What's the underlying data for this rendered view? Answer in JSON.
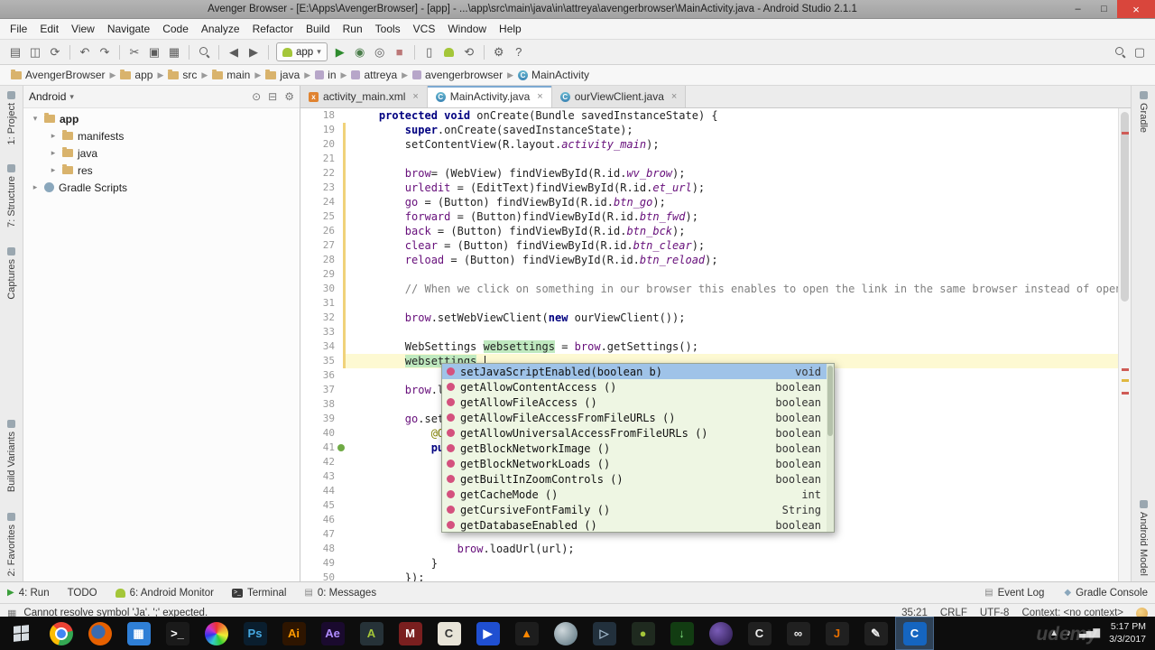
{
  "window": {
    "title": "Avenger Browser - [E:\\Apps\\AvengerBrowser] - [app] - ...\\app\\src\\main\\java\\in\\attreya\\avengerbrowser\\MainActivity.java - Android Studio 2.1.1",
    "controls": {
      "minimize": "–",
      "maximize": "□",
      "close": "×"
    }
  },
  "menu": [
    "File",
    "Edit",
    "View",
    "Navigate",
    "Code",
    "Analyze",
    "Refactor",
    "Build",
    "Run",
    "Tools",
    "VCS",
    "Window",
    "Help"
  ],
  "toolbar": {
    "run_config": "app",
    "items": [
      {
        "kind": "icon",
        "name": "open-icon",
        "glyph": "▤"
      },
      {
        "kind": "icon",
        "name": "save-all-icon",
        "glyph": "◫"
      },
      {
        "kind": "icon",
        "name": "sync-icon",
        "glyph": "⟳"
      },
      {
        "kind": "sep"
      },
      {
        "kind": "icon",
        "name": "undo-icon",
        "glyph": "↶"
      },
      {
        "kind": "icon",
        "name": "redo-icon",
        "glyph": "↷"
      },
      {
        "kind": "sep"
      },
      {
        "kind": "icon",
        "name": "cut-icon",
        "glyph": "✂"
      },
      {
        "kind": "icon",
        "name": "copy-icon",
        "glyph": "▣"
      },
      {
        "kind": "icon",
        "name": "paste-icon",
        "glyph": "▦"
      },
      {
        "kind": "sep"
      },
      {
        "kind": "mag",
        "name": "find-icon"
      },
      {
        "kind": "sep"
      },
      {
        "kind": "icon",
        "name": "back-icon",
        "glyph": "◀"
      },
      {
        "kind": "icon",
        "name": "forward-icon",
        "glyph": "▶"
      },
      {
        "kind": "sep"
      },
      {
        "kind": "runconfig",
        "name": "run-configuration-select"
      },
      {
        "kind": "icon",
        "name": "run-icon",
        "glyph": "▶",
        "color": "#2e8b2e"
      },
      {
        "kind": "icon",
        "name": "debug-icon",
        "glyph": "◉",
        "color": "#4a7d4a"
      },
      {
        "kind": "icon",
        "name": "coverage-icon",
        "glyph": "◎"
      },
      {
        "kind": "icon",
        "name": "stop-icon",
        "glyph": "■",
        "color": "#bb7777"
      },
      {
        "kind": "sep"
      },
      {
        "kind": "icon",
        "name": "avd-manager-icon",
        "glyph": "▯"
      },
      {
        "kind": "droid",
        "name": "sdk-manager-icon"
      },
      {
        "kind": "icon",
        "name": "gradle-sync-icon",
        "glyph": "⟲"
      },
      {
        "kind": "sep"
      },
      {
        "kind": "icon",
        "name": "settings-gear-icon",
        "glyph": "⚙"
      },
      {
        "kind": "icon",
        "name": "help-icon",
        "glyph": "?"
      },
      {
        "kind": "spacer"
      },
      {
        "kind": "mag",
        "name": "search-everywhere-icon"
      },
      {
        "kind": "icon",
        "name": "panel-layout-icon",
        "glyph": "▢"
      }
    ]
  },
  "breadcrumb": [
    {
      "label": "AvengerBrowser",
      "icon": "folder"
    },
    {
      "label": "app",
      "icon": "folder"
    },
    {
      "label": "src",
      "icon": "folder"
    },
    {
      "label": "main",
      "icon": "folder"
    },
    {
      "label": "java",
      "icon": "folder"
    },
    {
      "label": "in",
      "icon": "package"
    },
    {
      "label": "attreya",
      "icon": "package"
    },
    {
      "label": "avengerbrowser",
      "icon": "package"
    },
    {
      "label": "MainActivity",
      "icon": "class"
    }
  ],
  "project": {
    "view": "Android",
    "header_icons": [
      {
        "name": "scroll-to-source-icon",
        "glyph": "⊙"
      },
      {
        "name": "collapse-all-icon",
        "glyph": "⊟"
      },
      {
        "name": "panel-settings-icon",
        "glyph": "⚙"
      }
    ],
    "tree": [
      {
        "label": "app",
        "level": 0,
        "arrow": "▾",
        "icon": "folder",
        "bold": true
      },
      {
        "label": "manifests",
        "level": 1,
        "arrow": "▸",
        "icon": "folder"
      },
      {
        "label": "java",
        "level": 1,
        "arrow": "▸",
        "icon": "folder"
      },
      {
        "label": "res",
        "level": 1,
        "arrow": "▸",
        "icon": "folder"
      },
      {
        "label": "Gradle Scripts",
        "level": 0,
        "arrow": "▸",
        "icon": "gradle"
      }
    ]
  },
  "stripes": {
    "left_top": [
      "1: Project",
      "7: Structure",
      "Captures"
    ],
    "left_bottom": [
      "Build Variants",
      "2: Favorites"
    ],
    "right_top": [
      "Gradle"
    ],
    "right_bottom": [
      "Android Model"
    ]
  },
  "tabs": [
    {
      "label": "activity_main.xml",
      "icon": "xml",
      "active": false
    },
    {
      "label": "MainActivity.java",
      "icon": "class",
      "active": true
    },
    {
      "label": "ourViewClient.java",
      "icon": "class",
      "active": false
    }
  ],
  "editor": {
    "lines": [
      {
        "n": 18,
        "segs": [
          [
            "    ",
            ""
          ],
          [
            "protected",
            "k"
          ],
          [
            " ",
            ""
          ],
          [
            "void",
            "k"
          ],
          [
            " onCreate(Bundle savedInstanceState) {",
            ""
          ]
        ]
      },
      {
        "n": 19,
        "chg": true,
        "segs": [
          [
            "        ",
            ""
          ],
          [
            "super",
            "k"
          ],
          [
            ".onCreate(savedInstanceState);",
            ""
          ]
        ]
      },
      {
        "n": 20,
        "chg": true,
        "segs": [
          [
            "        setContentView(R.layout.",
            ""
          ],
          [
            "activity_main",
            "i"
          ],
          [
            ");",
            ""
          ]
        ]
      },
      {
        "n": 21,
        "chg": true,
        "segs": []
      },
      {
        "n": 22,
        "chg": true,
        "segs": [
          [
            "        ",
            ""
          ],
          [
            "brow",
            "f"
          ],
          [
            "= (WebView) findViewById(R.id.",
            ""
          ],
          [
            "wv_brow",
            "i"
          ],
          [
            ");",
            ""
          ]
        ]
      },
      {
        "n": 23,
        "chg": true,
        "segs": [
          [
            "        ",
            ""
          ],
          [
            "urledit",
            "f"
          ],
          [
            " = (EditText)findViewById(R.id.",
            ""
          ],
          [
            "et_url",
            "i"
          ],
          [
            ");",
            ""
          ]
        ]
      },
      {
        "n": 24,
        "chg": true,
        "segs": [
          [
            "        ",
            ""
          ],
          [
            "go",
            "f"
          ],
          [
            " = (Button) findViewById(R.id.",
            ""
          ],
          [
            "btn_go",
            "i"
          ],
          [
            ");",
            ""
          ]
        ]
      },
      {
        "n": 25,
        "chg": true,
        "segs": [
          [
            "        ",
            ""
          ],
          [
            "forward",
            "f"
          ],
          [
            " = (Button)findViewById(R.id.",
            ""
          ],
          [
            "btn_fwd",
            "i"
          ],
          [
            ");",
            ""
          ]
        ]
      },
      {
        "n": 26,
        "chg": true,
        "segs": [
          [
            "        ",
            ""
          ],
          [
            "back",
            "f"
          ],
          [
            " = (Button) findViewById(R.id.",
            ""
          ],
          [
            "btn_bck",
            "i"
          ],
          [
            ");",
            ""
          ]
        ]
      },
      {
        "n": 27,
        "chg": true,
        "segs": [
          [
            "        ",
            ""
          ],
          [
            "clear",
            "f"
          ],
          [
            " = (Button) findViewById(R.id.",
            ""
          ],
          [
            "btn_clear",
            "i"
          ],
          [
            ");",
            ""
          ]
        ]
      },
      {
        "n": 28,
        "chg": true,
        "segs": [
          [
            "        ",
            ""
          ],
          [
            "reload",
            "f"
          ],
          [
            " = (Button) findViewById(R.id.",
            ""
          ],
          [
            "btn_reload",
            "i"
          ],
          [
            ");",
            ""
          ]
        ]
      },
      {
        "n": 29,
        "chg": true,
        "segs": []
      },
      {
        "n": 30,
        "chg": true,
        "segs": [
          [
            "        ",
            ""
          ],
          [
            "// When we click on something in our browser this enables to open the link in the same browser instead of opening anohter bro",
            "c"
          ]
        ]
      },
      {
        "n": 31,
        "chg": true,
        "segs": []
      },
      {
        "n": 32,
        "chg": true,
        "segs": [
          [
            "        ",
            ""
          ],
          [
            "brow",
            "f"
          ],
          [
            ".setWebViewClient(",
            ""
          ],
          [
            "new",
            "k"
          ],
          [
            " ourViewClient());",
            ""
          ]
        ]
      },
      {
        "n": 33,
        "chg": true,
        "segs": []
      },
      {
        "n": 34,
        "chg": true,
        "segs": [
          [
            "        WebSettings ",
            ""
          ],
          [
            "websettings",
            "h"
          ],
          [
            " = ",
            ""
          ],
          [
            "brow",
            "f"
          ],
          [
            ".getSettings();",
            ""
          ]
        ]
      },
      {
        "n": 35,
        "chg": true,
        "current": true,
        "caret": true,
        "segs": [
          [
            "        ",
            ""
          ],
          [
            "websettings",
            "h"
          ],
          [
            ".",
            ""
          ]
        ]
      },
      {
        "n": 36,
        "segs": []
      },
      {
        "n": 37,
        "segs": [
          [
            "        ",
            ""
          ],
          [
            "brow",
            "f"
          ],
          [
            ".lo",
            ""
          ]
        ]
      },
      {
        "n": 38,
        "segs": []
      },
      {
        "n": 39,
        "segs": [
          [
            "        ",
            ""
          ],
          [
            "go",
            "f"
          ],
          [
            ".setO",
            ""
          ]
        ]
      },
      {
        "n": 40,
        "segs": [
          [
            "            ",
            ""
          ],
          [
            "@Ov",
            "a"
          ]
        ]
      },
      {
        "n": 41,
        "mark": true,
        "segs": [
          [
            "            ",
            ""
          ],
          [
            "pub",
            "k"
          ]
        ]
      },
      {
        "n": 42,
        "segs": []
      },
      {
        "n": 43,
        "segs": []
      },
      {
        "n": 44,
        "segs": []
      },
      {
        "n": 45,
        "segs": []
      },
      {
        "n": 46,
        "segs": []
      },
      {
        "n": 47,
        "segs": []
      },
      {
        "n": 48,
        "segs": [
          [
            "                ",
            ""
          ],
          [
            "brow",
            "f"
          ],
          [
            ".loadUrl(url);",
            ""
          ]
        ]
      },
      {
        "n": 49,
        "segs": [
          [
            "            }",
            ""
          ]
        ]
      },
      {
        "n": 50,
        "segs": [
          [
            "        });",
            ""
          ]
        ]
      }
    ]
  },
  "completion": {
    "items": [
      {
        "label": "setJavaScriptEnabled(boolean b)",
        "type": "void",
        "selected": true
      },
      {
        "label": "getAllowContentAccess ()",
        "type": "boolean"
      },
      {
        "label": "getAllowFileAccess ()",
        "type": "boolean"
      },
      {
        "label": "getAllowFileAccessFromFileURLs ()",
        "type": "boolean"
      },
      {
        "label": "getAllowUniversalAccessFromFileURLs ()",
        "type": "boolean"
      },
      {
        "label": "getBlockNetworkImage ()",
        "type": "boolean"
      },
      {
        "label": "getBlockNetworkLoads ()",
        "type": "boolean"
      },
      {
        "label": "getBuiltInZoomControls ()",
        "type": "boolean"
      },
      {
        "label": "getCacheMode ()",
        "type": "int"
      },
      {
        "label": "getCursiveFontFamily ()",
        "type": "String"
      },
      {
        "label": "getDatabaseEnabled ()",
        "type": "boolean"
      }
    ]
  },
  "bottom_bar": {
    "left": [
      {
        "label": "4: Run",
        "icon": "run",
        "glyph": "▶",
        "color": "#3a9e3a"
      },
      {
        "label": "TODO"
      },
      {
        "label": "6: Android Monitor",
        "icon": "droid"
      },
      {
        "label": "Terminal",
        "icon": "terminal"
      },
      {
        "label": "0: Messages",
        "icon": "messages",
        "glyph": "▤",
        "color": "#888888"
      }
    ],
    "right": [
      {
        "label": "Event Log",
        "icon": "event-log",
        "glyph": "▤",
        "color": "#888888"
      },
      {
        "label": "Gradle Console",
        "icon": "gradle-console",
        "glyph": "◆",
        "color": "#8aa7bc"
      }
    ]
  },
  "status_bar": {
    "corner_icon": "▦",
    "message": "Cannot resolve symbol 'Ja'. ';' expected.",
    "right": [
      {
        "name": "caret-position",
        "text": "35:21"
      },
      {
        "name": "line-endings",
        "text": "CRLF"
      },
      {
        "name": "encoding",
        "text": "UTF-8"
      },
      {
        "name": "context",
        "text": "Context: <no context>"
      }
    ]
  },
  "taskbar": {
    "icons": [
      {
        "name": "chrome-icon",
        "kind": "chrome"
      },
      {
        "name": "firefox-icon",
        "kind": "firefox"
      },
      {
        "name": "photos-icon",
        "glyph": "▦",
        "bg": "#2f7fd6",
        "color": "#ffffff"
      },
      {
        "name": "cmd-icon",
        "glyph": ">_",
        "bg": "#1a1a1a",
        "color": "#ffffff"
      },
      {
        "name": "color-wheel-icon",
        "kind": "wheel"
      },
      {
        "name": "photoshop-icon",
        "glyph": "Ps",
        "bg": "#0a1e2e",
        "color": "#46a8e0"
      },
      {
        "name": "illustrator-icon",
        "glyph": "Ai",
        "bg": "#2e1500",
        "color": "#ff9a00"
      },
      {
        "name": "after-effects-icon",
        "glyph": "Ae",
        "bg": "#1a0a2e",
        "color": "#b08cff"
      },
      {
        "name": "android-studio-icon",
        "glyph": "A",
        "bg": "#263238",
        "color": "#a4c639"
      },
      {
        "name": "media-player-icon",
        "glyph": "M",
        "bg": "#7a1f1f",
        "color": "#ffffff"
      },
      {
        "name": "camtasia-light-icon",
        "glyph": "C",
        "bg": "#e8e4d8",
        "color": "#333333"
      },
      {
        "name": "movie-app-icon",
        "glyph": "▶",
        "bg": "#1f4fd1",
        "color": "#ffffff"
      },
      {
        "name": "vlc-icon",
        "kind": "vlc",
        "glyph": "▲"
      },
      {
        "name": "sphere-app-icon",
        "kind": "sphere"
      },
      {
        "name": "vmware-icon",
        "glyph": "▷",
        "bg": "#22303c",
        "color": "#9fb6c9"
      },
      {
        "name": "android-device-icon",
        "glyph": "●",
        "bg": "#1f2a1f",
        "color": "#a4c639"
      },
      {
        "name": "downloader-icon",
        "glyph": "↓",
        "bg": "#123c12",
        "color": "#7fe07f"
      },
      {
        "name": "eclipse-icon",
        "kind": "eclipse"
      },
      {
        "name": "camtasia-dark-icon",
        "glyph": "C",
        "bg": "#202020",
        "color": "#eeeeee"
      },
      {
        "name": "infinity-app-icon",
        "glyph": "∞",
        "bg": "#202020",
        "color": "#eeeeee"
      },
      {
        "name": "java-icon",
        "glyph": "J",
        "bg": "#202020",
        "color": "#e76f00"
      },
      {
        "name": "pen-tablet-icon",
        "glyph": "✎",
        "bg": "#202020",
        "color": "#eeeeee"
      },
      {
        "name": "camtasia-recorder-icon",
        "glyph": "C",
        "bg": "#1565c0",
        "color": "#ffffff",
        "active": true
      }
    ],
    "tray": [
      {
        "name": "hidden-icons-icon",
        "glyph": "▲"
      },
      {
        "name": "volume-icon",
        "glyph": "♪"
      },
      {
        "name": "network-icon",
        "glyph": "▃▅▇"
      }
    ],
    "clock": {
      "time": "5:17 PM",
      "date": "3/3/2017"
    }
  },
  "watermark": "udemy"
}
